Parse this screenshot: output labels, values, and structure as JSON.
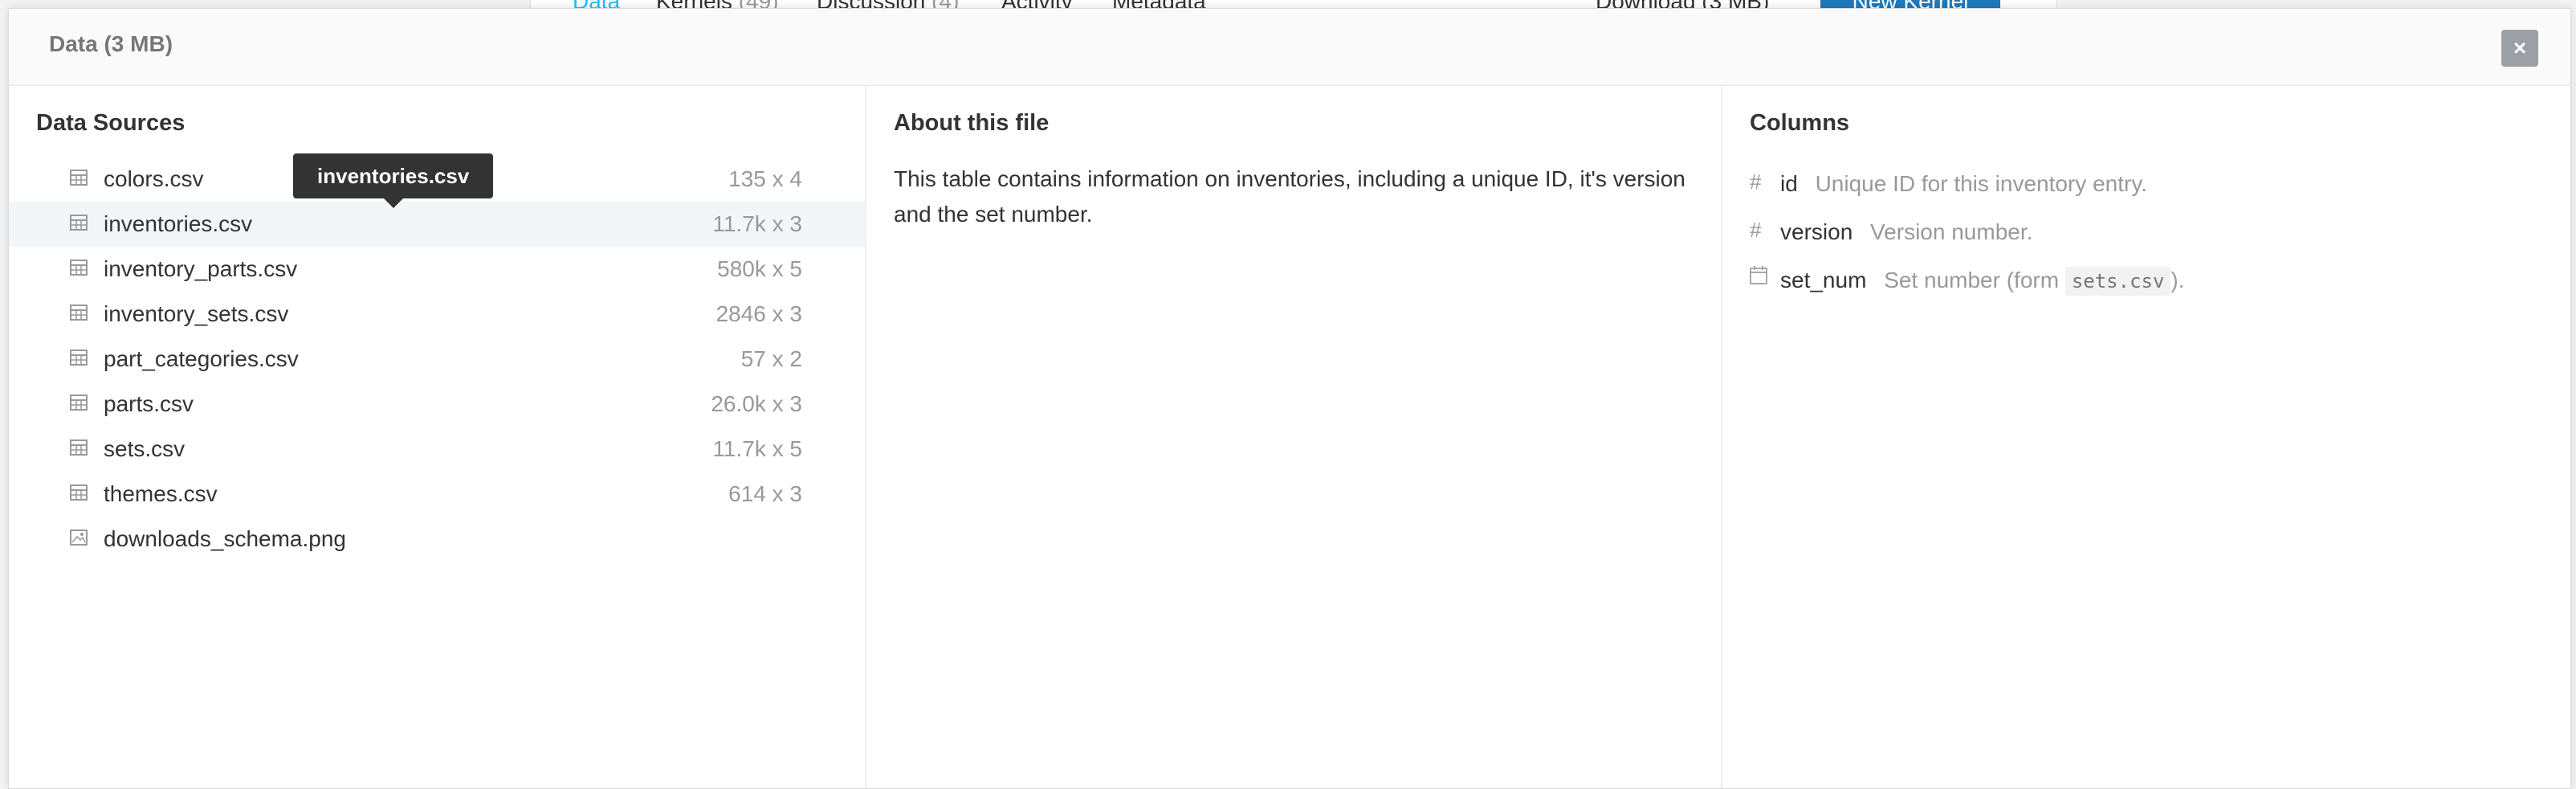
{
  "background": {
    "tabs": [
      {
        "label": "Data",
        "count": ""
      },
      {
        "label": "Kernels",
        "count": "(49)"
      },
      {
        "label": "Discussion",
        "count": "(4)"
      },
      {
        "label": "Activity",
        "count": ""
      },
      {
        "label": "Metadata",
        "count": ""
      }
    ],
    "download_label": "Download (3 MB)",
    "new_kernel_label": "New Kernel"
  },
  "modal": {
    "title": "Data (3 MB)",
    "close_label": "×"
  },
  "sources": {
    "title": "Data Sources",
    "tooltip": "inventories.csv",
    "files": [
      {
        "name": "colors.csv",
        "dims": "135 x 4",
        "icon": "table-icon"
      },
      {
        "name": "inventories.csv",
        "dims": "11.7k x 3",
        "icon": "table-icon"
      },
      {
        "name": "inventory_parts.csv",
        "dims": "580k x 5",
        "icon": "table-icon"
      },
      {
        "name": "inventory_sets.csv",
        "dims": "2846 x 3",
        "icon": "table-icon"
      },
      {
        "name": "part_categories.csv",
        "dims": "57 x 2",
        "icon": "table-icon"
      },
      {
        "name": "parts.csv",
        "dims": "26.0k x 3",
        "icon": "table-icon"
      },
      {
        "name": "sets.csv",
        "dims": "11.7k x 5",
        "icon": "table-icon"
      },
      {
        "name": "themes.csv",
        "dims": "614 x 3",
        "icon": "table-icon"
      },
      {
        "name": "downloads_schema.png",
        "dims": "",
        "icon": "image-icon"
      }
    ]
  },
  "about": {
    "title": "About this file",
    "text": "This table contains information on inventories, including a unique ID, it's version and the set number."
  },
  "columns": {
    "title": "Columns",
    "items": [
      {
        "icon": "hash-icon",
        "name": "id",
        "desc": "Unique ID for this inventory entry."
      },
      {
        "icon": "hash-icon",
        "name": "version",
        "desc": "Version number."
      },
      {
        "icon": "calendar-icon",
        "name": "set_num",
        "desc_pre": "Set number (form",
        "desc_code": "sets.csv",
        "desc_post": ")."
      }
    ]
  }
}
